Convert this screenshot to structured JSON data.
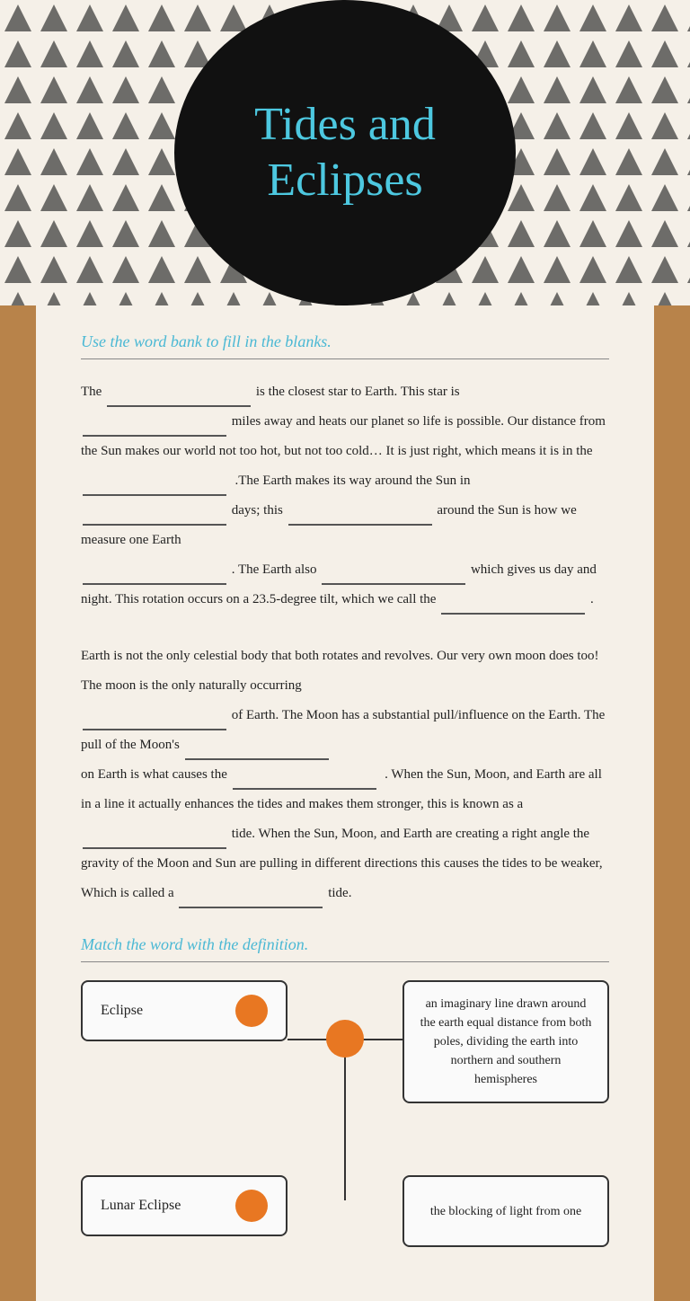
{
  "header": {
    "title_line1": "Tides and",
    "title_line2": "Eclipses"
  },
  "fill_blanks": {
    "instruction": "Use the word bank to fill in the blanks.",
    "paragraph1": "The",
    "p1_end": "is the closest star to Earth. This star is",
    "p1b": "miles away and heats our planet so life is possible. Our distance from the Sun makes our world not too hot, but not too cold… It is just right, which means it is in the",
    "p1c": ".The Earth makes its way around the Sun in",
    "p1d": "days; this",
    "p1e": "around the Sun is how we measure one Earth",
    "p1f": ". The Earth also",
    "p1g": "which gives us day and night. This rotation occurs on a 23.5-degree tilt, which we call the",
    "p1h": ".",
    "paragraph2": "Earth is not the only celestial body that both rotates and revolves. Our very own moon does too! The moon is the only naturally occurring",
    "p2b": "of Earth. The Moon has a substantial pull/influence on the Earth. The pull of the Moon's",
    "p2c": "on Earth is what causes the",
    "p2d": ". When the Sun, Moon, and Earth are all in a line it actually enhances the tides and makes them stronger, this is known as a",
    "p2e": "tide. When the Sun, Moon, and Earth are creating a right angle the gravity of the Moon and Sun are pulling in different directions this causes the tides to be weaker, Which is called a",
    "p2f": "tide."
  },
  "match_section": {
    "instruction": "Match the word with the definition.",
    "pairs": [
      {
        "word": "Eclipse",
        "definition": "an imaginary line drawn around the earth equal distance from both poles, dividing the earth into northern and southern hemispheres"
      },
      {
        "word": "Lunar Eclipse",
        "definition": "the blocking of light from one"
      }
    ]
  }
}
